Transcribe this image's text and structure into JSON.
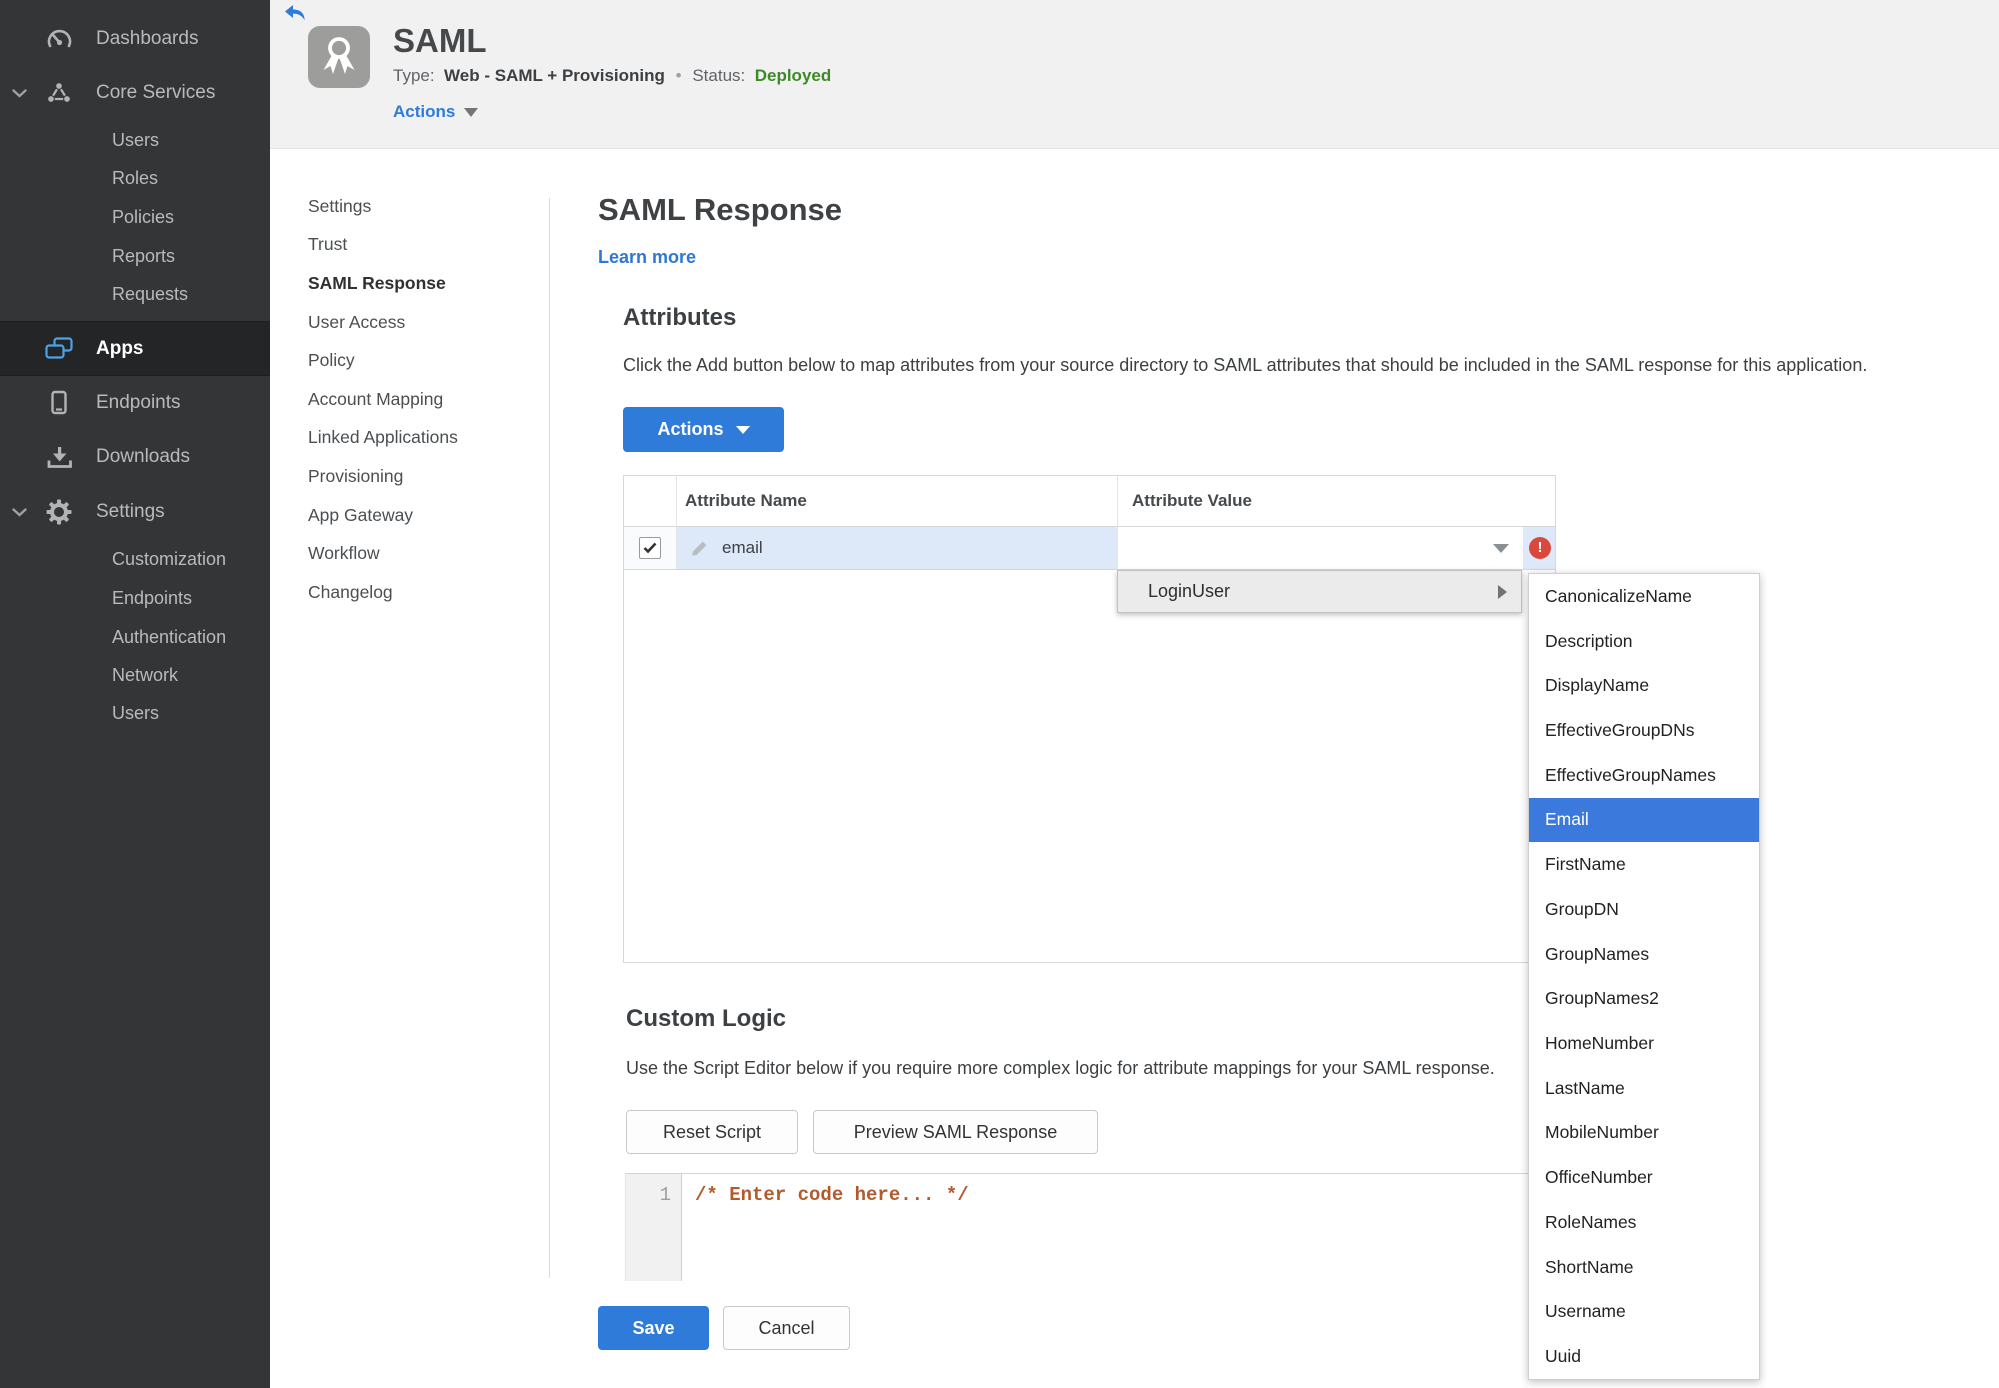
{
  "colors": {
    "accent_blue": "#2e7bd9",
    "selection_blue": "#3b79dd",
    "status_green": "#3e8a28",
    "error_red": "#d9483b",
    "code_orange": "#b35a2d",
    "sidebar_bg": "#333536",
    "apps_icon_blue": "#4da3ea",
    "row_highlight": "#dde9f8"
  },
  "sidebar": {
    "items": [
      {
        "label": "Dashboards",
        "icon": "gauge-icon"
      },
      {
        "label": "Core Services",
        "icon": "core-services-icon"
      },
      {
        "label": "Users"
      },
      {
        "label": "Roles"
      },
      {
        "label": "Policies"
      },
      {
        "label": "Reports"
      },
      {
        "label": "Requests"
      },
      {
        "label": "Apps",
        "icon": "apps-icon",
        "active": true
      },
      {
        "label": "Endpoints",
        "icon": "endpoint-icon"
      },
      {
        "label": "Downloads",
        "icon": "download-icon"
      },
      {
        "label": "Settings",
        "icon": "gear-icon"
      },
      {
        "label": "Customization"
      },
      {
        "label": "Endpoints"
      },
      {
        "label": "Authentication"
      },
      {
        "label": "Network"
      },
      {
        "label": "Users"
      }
    ]
  },
  "header": {
    "title": "SAML",
    "type_label": "Type:",
    "type_value": "Web - SAML + Provisioning",
    "separator": "•",
    "status_label": "Status:",
    "status_value": "Deployed",
    "actions_label": "Actions"
  },
  "subnav": {
    "items": [
      {
        "label": "Settings"
      },
      {
        "label": "Trust"
      },
      {
        "label": "SAML Response",
        "active": true
      },
      {
        "label": "User Access"
      },
      {
        "label": "Policy"
      },
      {
        "label": "Account Mapping"
      },
      {
        "label": "Linked Applications"
      },
      {
        "label": "Provisioning"
      },
      {
        "label": "App Gateway"
      },
      {
        "label": "Workflow"
      },
      {
        "label": "Changelog"
      }
    ]
  },
  "main": {
    "title": "SAML Response",
    "learn_more": "Learn more",
    "attributes": {
      "heading": "Attributes",
      "description": "Click the Add button below to map attributes from your source directory to SAML attributes that should be included in the SAML response for this application.",
      "actions_button": "Actions",
      "columns": {
        "name": "Attribute Name",
        "value": "Attribute Value"
      },
      "row": {
        "name": "email",
        "checked": true
      },
      "error_glyph": "!"
    },
    "value_menu": {
      "root": "LoginUser",
      "selected": "Email",
      "options": [
        {
          "label": "CanonicalizeName"
        },
        {
          "label": "Description"
        },
        {
          "label": "DisplayName"
        },
        {
          "label": "EffectiveGroupDNs"
        },
        {
          "label": "EffectiveGroupNames"
        },
        {
          "label": "Email",
          "selected": true
        },
        {
          "label": "FirstName"
        },
        {
          "label": "GroupDN"
        },
        {
          "label": "GroupNames"
        },
        {
          "label": "GroupNames2"
        },
        {
          "label": "HomeNumber"
        },
        {
          "label": "LastName"
        },
        {
          "label": "MobileNumber"
        },
        {
          "label": "OfficeNumber"
        },
        {
          "label": "RoleNames"
        },
        {
          "label": "ShortName"
        },
        {
          "label": "Username"
        },
        {
          "label": "Uuid"
        }
      ]
    },
    "custom_logic": {
      "heading": "Custom Logic",
      "description": "Use the Script Editor below if you require more complex logic for attribute mappings for your SAML response.",
      "reset_button": "Reset Script",
      "preview_button": "Preview SAML Response",
      "editor": {
        "line_number": "1",
        "code": "/* Enter code here... */"
      }
    },
    "save_button": "Save",
    "cancel_button": "Cancel"
  }
}
